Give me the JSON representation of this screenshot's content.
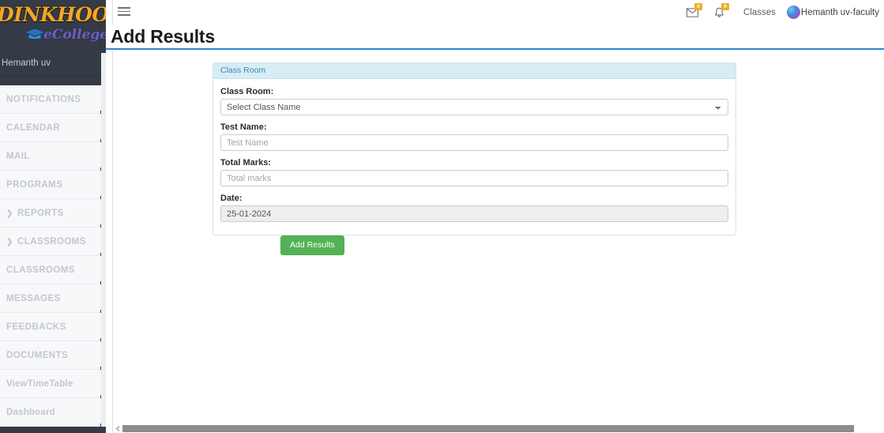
{
  "brand": {
    "logo_main": "DINKHOO!",
    "logo_sub": "eCollege",
    "logo_icon": "graduation-cap-icon",
    "user_name": "Hemanth uv"
  },
  "sidebar": {
    "items": [
      {
        "label": "NOTIFICATIONS",
        "expandable": false,
        "mixed_case": false
      },
      {
        "label": "CALENDAR",
        "expandable": false,
        "mixed_case": false
      },
      {
        "label": "MAIL",
        "expandable": false,
        "mixed_case": false
      },
      {
        "label": "PROGRAMS",
        "expandable": false,
        "mixed_case": false
      },
      {
        "label": "REPORTS",
        "expandable": true,
        "mixed_case": false
      },
      {
        "label": "CLASSROOMS",
        "expandable": true,
        "mixed_case": false
      },
      {
        "label": "CLASSROOMS",
        "expandable": false,
        "mixed_case": false
      },
      {
        "label": "MESSAGES",
        "expandable": false,
        "mixed_case": false
      },
      {
        "label": "FEEDBACKS",
        "expandable": false,
        "mixed_case": false
      },
      {
        "label": "DOCUMENTS",
        "expandable": false,
        "mixed_case": false
      },
      {
        "label": "ViewTimeTable",
        "expandable": false,
        "mixed_case": true
      },
      {
        "label": "Dashboard",
        "expandable": false,
        "mixed_case": true
      }
    ]
  },
  "topbar": {
    "menu_toggle_icon": "hamburger-icon",
    "mail": {
      "icon": "envelope-icon",
      "badge": "0"
    },
    "notifications": {
      "icon": "bell-icon",
      "badge": "0"
    },
    "classes_link": "Classes",
    "avatar_icon": "user-avatar",
    "user_label": "Hemanth uv-faculty"
  },
  "page": {
    "title": "Add Results",
    "accent_color": "#2e86d4"
  },
  "form": {
    "panel_title": "Class Room",
    "fields": [
      {
        "key": "class_room",
        "label": "Class Room:",
        "type": "select",
        "value": "Select Class Name",
        "options": [
          "Select Class Name"
        ]
      },
      {
        "key": "test_name",
        "label": "Test Name:",
        "type": "text",
        "value": "",
        "placeholder": "Test Name"
      },
      {
        "key": "total_marks",
        "label": "Total Marks:",
        "type": "text",
        "value": "",
        "placeholder": "Total marks"
      },
      {
        "key": "date",
        "label": "Date:",
        "type": "text-disabled",
        "value": "25-01-2024",
        "placeholder": ""
      }
    ],
    "submit_label": "Add Results",
    "submit_color": "#55b155"
  },
  "scrollbar": {
    "left_arrow_icon": "chevron-left-icon",
    "right_arrow_icon": "chevron-right-icon"
  }
}
